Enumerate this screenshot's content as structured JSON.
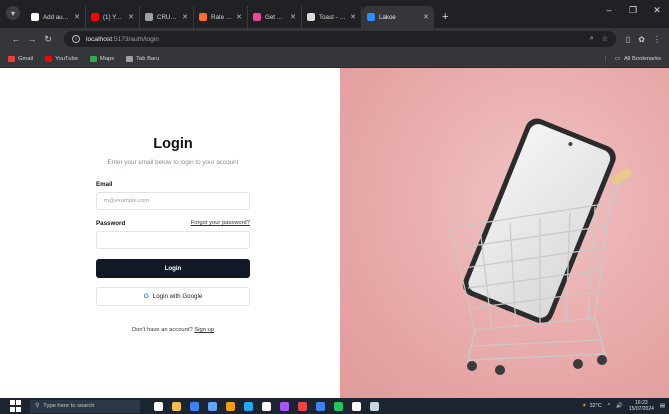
{
  "browser": {
    "tabs": [
      {
        "label": "Add auth user",
        "icon": "github-icon",
        "color": "#ffffff"
      },
      {
        "label": "(1) YouTube",
        "icon": "youtube-icon",
        "color": "#ff0000"
      },
      {
        "label": "CRUD dengan",
        "icon": "doc-icon",
        "color": "#9aa0a6"
      },
      {
        "label": "Rate Limiting |",
        "icon": "rate-icon",
        "color": "#ff6b2d"
      },
      {
        "label": "Get Started | Ru",
        "icon": "get-started-icon",
        "color": "#e94b9a"
      },
      {
        "label": "Toast - shadcn/",
        "icon": "shadcn-icon",
        "color": "#dddddd"
      },
      {
        "label": "Lakoe",
        "icon": "lakoe-icon",
        "color": "#2d8cff"
      }
    ],
    "new_tab": "+",
    "url_host": "localhost",
    "url_path": ":5173/auth/login",
    "bookmarks": [
      {
        "label": "Gmail",
        "color": "#ea4335"
      },
      {
        "label": "YouTube",
        "color": "#ff0000"
      },
      {
        "label": "Maps",
        "color": "#34a853"
      },
      {
        "label": "Tab Baru",
        "color": "#9aa0a6"
      }
    ],
    "all_bookmarks": "All Bookmarks"
  },
  "login": {
    "title": "Login",
    "subtitle": "Enter your email below to login to your account",
    "email_label": "Email",
    "email_placeholder": "m@example.com",
    "password_label": "Password",
    "forgot_link": "Forgot your password?",
    "login_button": "Login",
    "google_button": "Login with Google",
    "signup_prompt": "Don't have an account?",
    "signup_link": "Sign up"
  },
  "taskbar": {
    "search_placeholder": "Type here to search",
    "apps": [
      {
        "name": "task-view",
        "color": "#ffffff"
      },
      {
        "name": "file-explorer",
        "color": "#f5c04a"
      },
      {
        "name": "mail",
        "color": "#3b82f6"
      },
      {
        "name": "store",
        "color": "#60a5fa"
      },
      {
        "name": "chrome",
        "color": "#f59e0b"
      },
      {
        "name": "edge",
        "color": "#22a7f0"
      },
      {
        "name": "tiktok",
        "color": "#ffffff"
      },
      {
        "name": "figma",
        "color": "#a855f7"
      },
      {
        "name": "opera",
        "color": "#ef4444"
      },
      {
        "name": "vscode",
        "color": "#3b82f6"
      },
      {
        "name": "whatsapp",
        "color": "#22c55e"
      },
      {
        "name": "github",
        "color": "#ffffff"
      },
      {
        "name": "obs",
        "color": "#cbd5e1"
      }
    ],
    "weather": "32°C",
    "time": "16:23",
    "date": "15/07/2024"
  }
}
